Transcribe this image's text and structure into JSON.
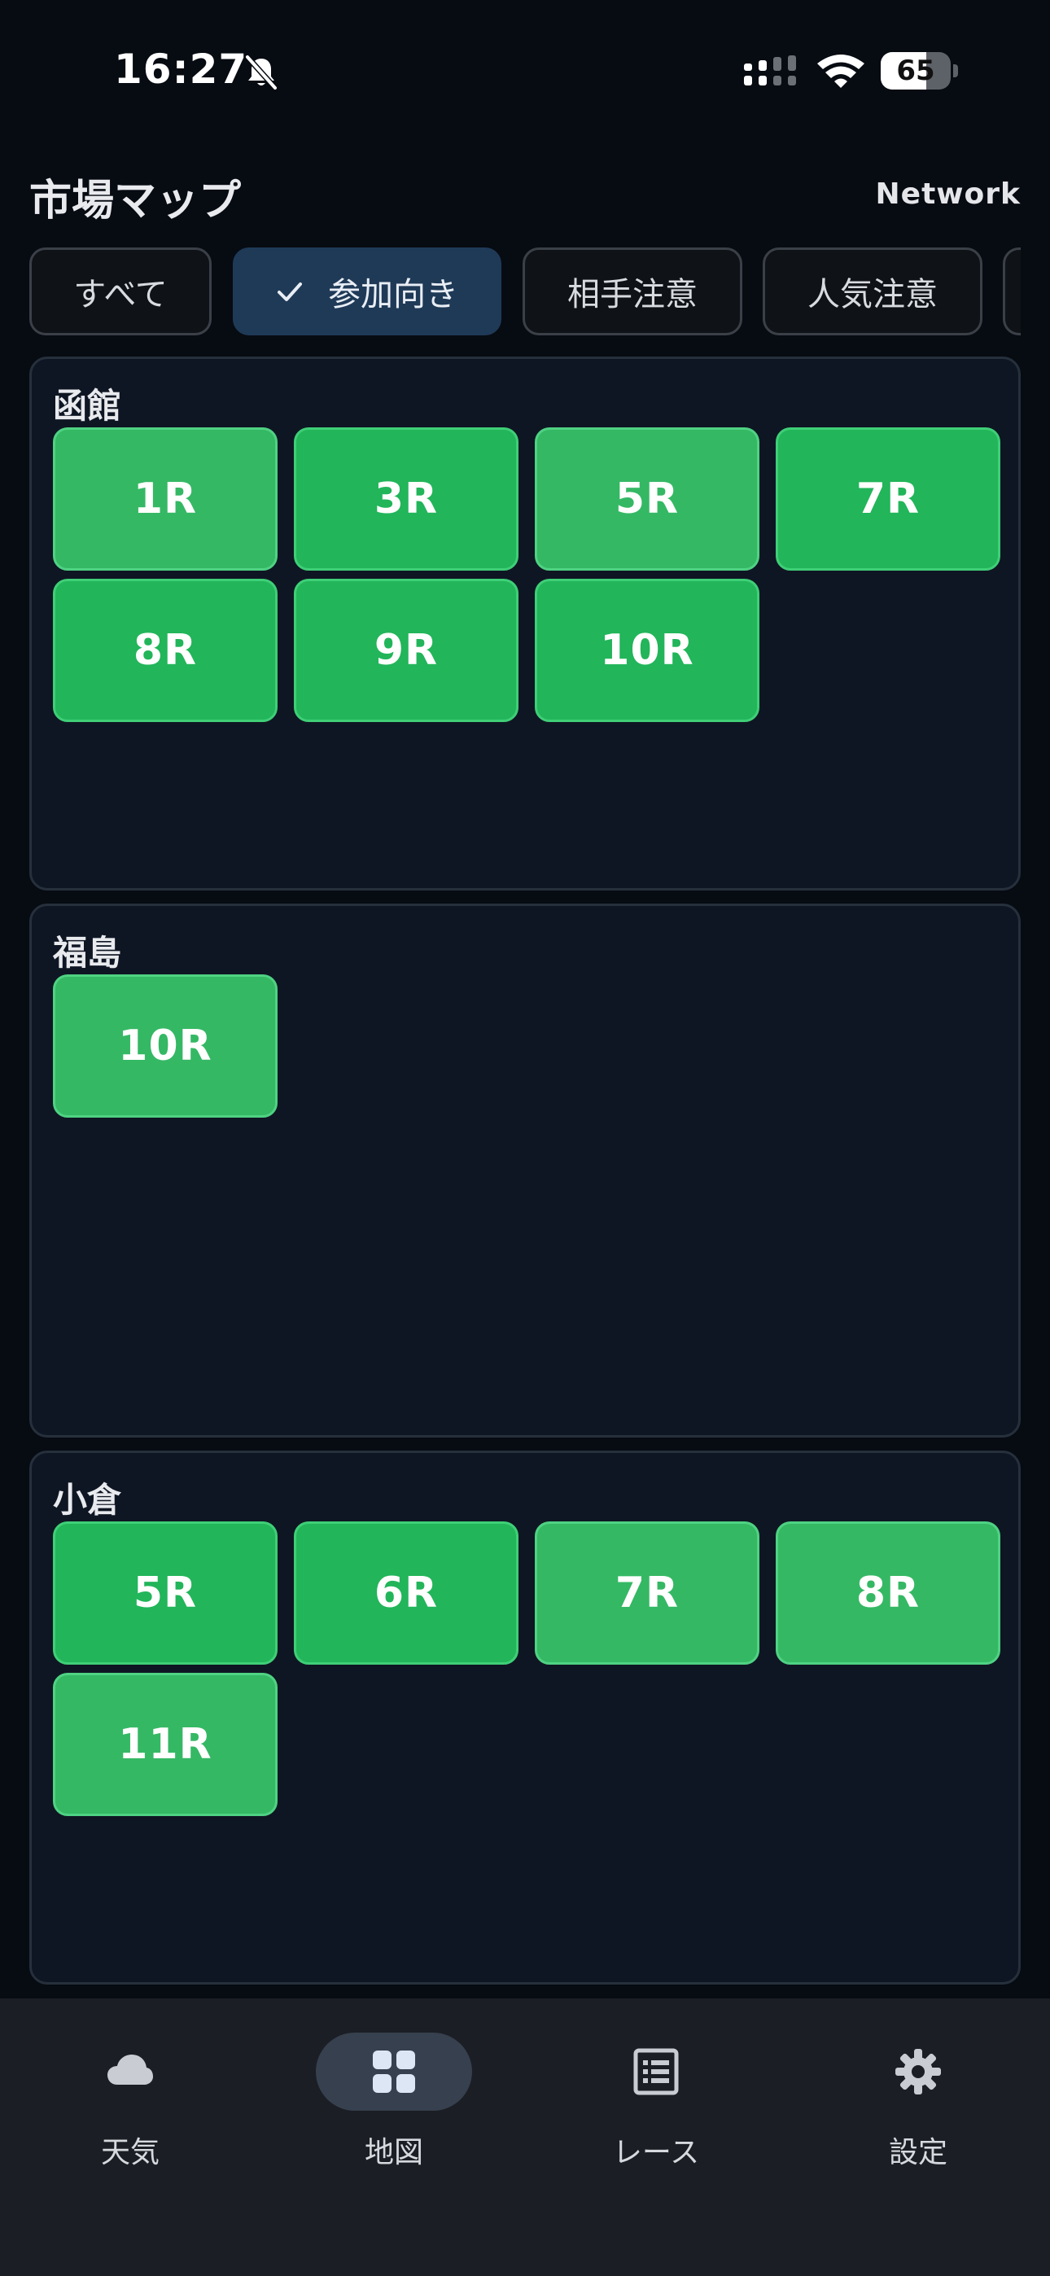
{
  "status_bar": {
    "time": "16:27",
    "battery_level": "65",
    "battery_fraction": 0.65
  },
  "header": {
    "title": "市場マップ",
    "network_label": "Network"
  },
  "filters": [
    {
      "label": "すべて",
      "active": false
    },
    {
      "label": "参加向き",
      "active": true
    },
    {
      "label": "相手注意",
      "active": false
    },
    {
      "label": "人気注意",
      "active": false
    }
  ],
  "venues": [
    {
      "name": "函館",
      "races": [
        {
          "label": "1R",
          "tone": "light"
        },
        {
          "label": "3R",
          "tone": "strong"
        },
        {
          "label": "5R",
          "tone": "light"
        },
        {
          "label": "7R",
          "tone": "strong"
        },
        {
          "label": "8R",
          "tone": "strong"
        },
        {
          "label": "9R",
          "tone": "strong"
        },
        {
          "label": "10R",
          "tone": "strong"
        }
      ]
    },
    {
      "name": "福島",
      "races": [
        {
          "label": "10R",
          "tone": "light"
        }
      ]
    },
    {
      "name": "小倉",
      "races": [
        {
          "label": "5R",
          "tone": "strong"
        },
        {
          "label": "6R",
          "tone": "strong"
        },
        {
          "label": "7R",
          "tone": "light"
        },
        {
          "label": "8R",
          "tone": "light"
        },
        {
          "label": "11R",
          "tone": "light"
        }
      ]
    }
  ],
  "bottom_nav": [
    {
      "label": "天気",
      "icon": "cloud-icon",
      "active": false
    },
    {
      "label": "地図",
      "icon": "grid-icon",
      "active": true
    },
    {
      "label": "レース",
      "icon": "list-icon",
      "active": false
    },
    {
      "label": "設定",
      "icon": "gear-icon",
      "active": false
    }
  ],
  "colors": {
    "background": "#070b12",
    "card": "#0f1623",
    "race_strong": "#22b55a",
    "race_light": "#35b864",
    "chip_active": "#1f3a57",
    "nav_bg": "#1b1e24"
  }
}
